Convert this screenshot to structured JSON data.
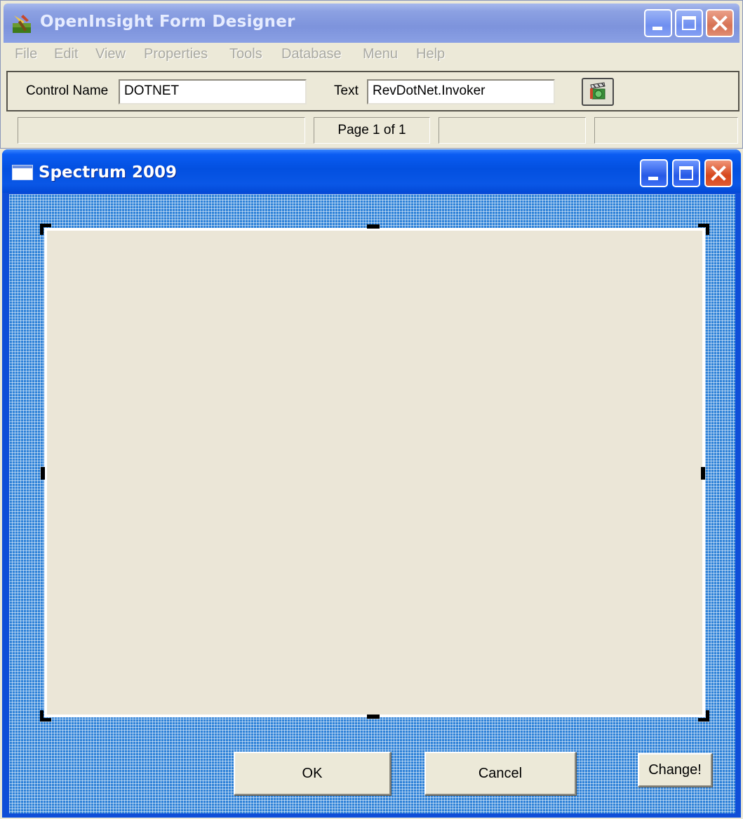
{
  "outer_window": {
    "title": "OpenInsight Form Designer",
    "app_icon": "form-designer-app-icon",
    "buttons": [
      "minimize",
      "maximize",
      "close"
    ]
  },
  "menu": {
    "items": [
      "File",
      "Edit",
      "View",
      "Properties",
      "Tools",
      "Database",
      "Menu",
      "Help"
    ]
  },
  "toolbar": {
    "control_name_label": "Control Name",
    "control_name_value": "DOTNET",
    "text_label": "Text",
    "text_value": "RevDotNet.Invoker",
    "tool_button_icon": "clapperboard-icon"
  },
  "statusbar": {
    "page_text": "Page 1 of 1"
  },
  "inner_window": {
    "title": "Spectrum 2009",
    "app_icon": "window-icon",
    "buttons": [
      "minimize",
      "maximize",
      "close"
    ]
  },
  "form": {
    "control_name": "DOTNET",
    "ok_label": "OK",
    "cancel_label": "Cancel",
    "change_label": "Change!"
  },
  "colors": {
    "titlebar_inactive": "#7d93dc",
    "titlebar_active": "#0350e0",
    "window_face": "#ece9d8",
    "grid_blue": "#2f82d8",
    "control_face": "#ebe6d7"
  }
}
